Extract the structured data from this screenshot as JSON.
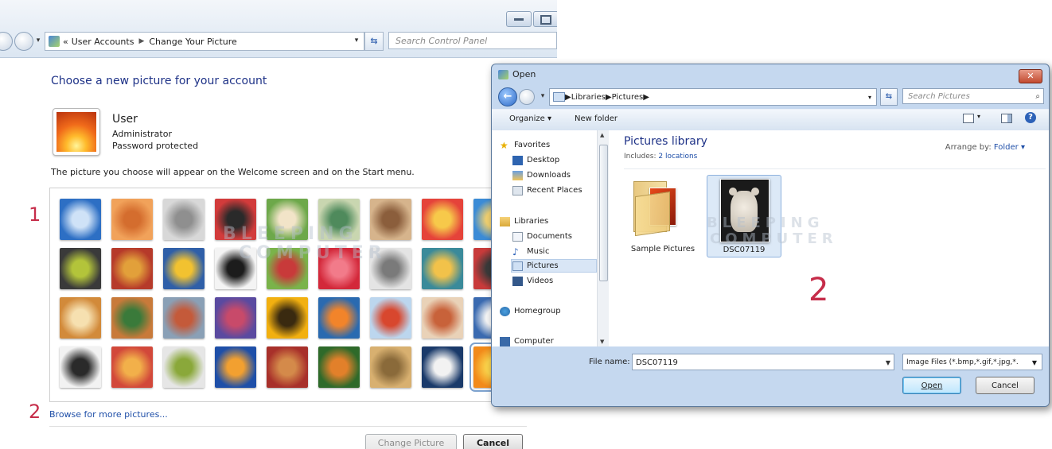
{
  "control_panel": {
    "breadcrumb_prefix": "«",
    "breadcrumb": [
      "User Accounts",
      "Change Your Picture"
    ],
    "search_placeholder": "Search Control Panel",
    "heading": "Choose a new picture for your account",
    "user": {
      "name": "User",
      "role": "Administrator",
      "status": "Password protected"
    },
    "description": "The picture you choose will appear on the Welcome screen and on the Start menu.",
    "step1": "1",
    "step2": "2",
    "browse_link": "Browse for more pictures...",
    "buttons": {
      "change_picture": "Change Picture",
      "cancel": "Cancel"
    },
    "pictures": [
      {
        "name": "ferris-wheel",
        "colors": [
          "#2d6fc4",
          "#cfe2f7"
        ]
      },
      {
        "name": "starfish",
        "colors": [
          "#f1a25a",
          "#d46d2e"
        ]
      },
      {
        "name": "robot-toy",
        "colors": [
          "#d8d8d8",
          "#8f8f8f"
        ]
      },
      {
        "name": "vinyl-record",
        "colors": [
          "#d23b3b",
          "#2a2a2a"
        ]
      },
      {
        "name": "lucky-cat",
        "colors": [
          "#6da84a",
          "#f2e4c8"
        ]
      },
      {
        "name": "globe",
        "colors": [
          "#c9d6b0",
          "#4f8a5c"
        ]
      },
      {
        "name": "kitten",
        "colors": [
          "#d6b48c",
          "#8b5e3c"
        ]
      },
      {
        "name": "red-flower",
        "colors": [
          "#e5433a",
          "#f7c94a"
        ]
      },
      {
        "name": "sailboat-partial",
        "colors": [
          "#3b8bd6",
          "#f0d070"
        ]
      },
      {
        "name": "green-ball",
        "colors": [
          "#3a3a3a",
          "#b3c43a"
        ]
      },
      {
        "name": "books",
        "colors": [
          "#b63a2a",
          "#e2a03a"
        ]
      },
      {
        "name": "yellow-leaf",
        "colors": [
          "#2f5fa8",
          "#f2c230"
        ]
      },
      {
        "name": "border-collie",
        "colors": [
          "#f4f4f4",
          "#1c1c1c"
        ]
      },
      {
        "name": "crayons",
        "colors": [
          "#7ab34a",
          "#c83a3a"
        ]
      },
      {
        "name": "red-starburst",
        "colors": [
          "#d3283a",
          "#f27b8a"
        ]
      },
      {
        "name": "jacks",
        "colors": [
          "#e4e4e4",
          "#7a7a7a"
        ]
      },
      {
        "name": "stairs",
        "colors": [
          "#3a8a9a",
          "#f2c24a"
        ]
      },
      {
        "name": "partial-red",
        "colors": [
          "#c83a3a",
          "#3a3a3a"
        ]
      },
      {
        "name": "guitar",
        "colors": [
          "#d28a3a",
          "#f6e0b0"
        ]
      },
      {
        "name": "pomeranian",
        "colors": [
          "#c87a3a",
          "#3a7a3a"
        ]
      },
      {
        "name": "robot-figure",
        "colors": [
          "#8aa0b6",
          "#c45a3a"
        ]
      },
      {
        "name": "fabric",
        "colors": [
          "#5a4aa0",
          "#c84a6a"
        ]
      },
      {
        "name": "sunflower",
        "colors": [
          "#f2b010",
          "#3a2a10"
        ]
      },
      {
        "name": "fish",
        "colors": [
          "#2a6ab0",
          "#f2842a"
        ]
      },
      {
        "name": "hot-air-balloon",
        "colors": [
          "#bcd6ee",
          "#d8472e"
        ]
      },
      {
        "name": "toy-face",
        "colors": [
          "#e9d2b8",
          "#c8623a"
        ]
      },
      {
        "name": "partial-boat",
        "colors": [
          "#3a6ab0",
          "#f6f6f6"
        ]
      },
      {
        "name": "soccer-ball",
        "colors": [
          "#f2f2f2",
          "#2a2a2a"
        ]
      },
      {
        "name": "striped-cloth",
        "colors": [
          "#d2483a",
          "#f2b04a"
        ]
      },
      {
        "name": "marbles",
        "colors": [
          "#e6e6e6",
          "#8aa83a"
        ]
      },
      {
        "name": "window",
        "colors": [
          "#1e4fa8",
          "#f2a030"
        ]
      },
      {
        "name": "patterned-rug",
        "colors": [
          "#a8302a",
          "#d48a4a"
        ]
      },
      {
        "name": "butterfly",
        "colors": [
          "#2e6a2a",
          "#e2802a"
        ]
      },
      {
        "name": "shell",
        "colors": [
          "#d8b070",
          "#8a6a3a"
        ]
      },
      {
        "name": "lighthouse",
        "colors": [
          "#1a3a6a",
          "#f2f2f2"
        ]
      },
      {
        "name": "orange-flower",
        "colors": [
          "#f28a1a",
          "#fad24a"
        ]
      }
    ]
  },
  "open_dialog": {
    "title": "Open",
    "breadcrumb": [
      "Libraries",
      "Pictures"
    ],
    "search_placeholder": "Search Pictures",
    "toolbar": {
      "organize": "Organize ▾",
      "new_folder": "New folder"
    },
    "nav": {
      "favorites": "Favorites",
      "favorites_items": [
        "Desktop",
        "Downloads",
        "Recent Places"
      ],
      "libraries": "Libraries",
      "libraries_items": [
        "Documents",
        "Music",
        "Pictures",
        "Videos"
      ],
      "homegroup": "Homegroup",
      "computer": "Computer"
    },
    "library_title": "Pictures library",
    "includes_label": "Includes:",
    "includes_link": "2 locations",
    "arrange_label": "Arrange by:",
    "arrange_value": "Folder ▾",
    "files": [
      "Sample Pictures",
      "DSC07119"
    ],
    "step2": "2",
    "file_name_label": "File name:",
    "file_name_value": "DSC07119",
    "file_type": "Image Files (*.bmp,*.gif,*.jpg,*.",
    "open_button": "Open",
    "cancel_button": "Cancel"
  },
  "watermark": {
    "line1": "BLEEPING",
    "line2": "COMPUTER"
  }
}
